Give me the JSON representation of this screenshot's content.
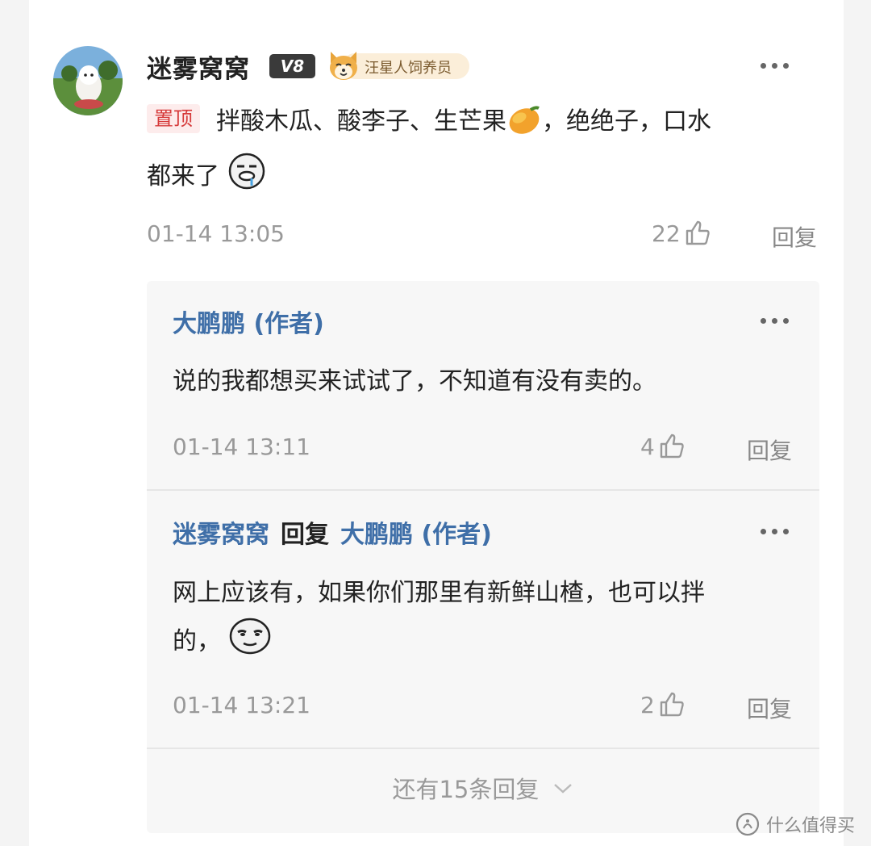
{
  "comment": {
    "username": "迷雾窝窝",
    "level_badge": "V8",
    "medal": "汪星人饲养员",
    "pin_label": "置顶",
    "line1": "拌酸木瓜、酸李子、生芒果",
    "line1_tail": "，绝绝子，口水",
    "line2": "都来了",
    "time": "01-14 13:05",
    "likes": "22",
    "reply_label": "回复"
  },
  "replies": [
    {
      "author": "大鹏鹏 (作者)",
      "text": "说的我都想买来试试了，不知道有没有卖的。",
      "time": "01-14 13:11",
      "likes": "4",
      "reply_label": "回复"
    },
    {
      "author": "迷雾窝窝",
      "reply_word": "回复",
      "target": "大鹏鹏 (作者)",
      "line1": "网上应该有，如果你们那里有新鲜山楂，也可以拌",
      "line2": "的，",
      "time": "01-14 13:21",
      "likes": "2",
      "reply_label": "回复"
    }
  ],
  "more_replies": "还有15条回复",
  "watermark": "什么值得买",
  "icons": {
    "more": "more-dots-icon",
    "like": "thumbs-up-icon",
    "chevron": "chevron-down-icon",
    "mango": "mango-emoji",
    "drool": "drooling-face-emoji",
    "smirk": "smirk-face-emoji"
  },
  "colors": {
    "author_blue": "#3f6fa8",
    "pin_red": "#d63a3a",
    "meta_gray": "#999999"
  }
}
